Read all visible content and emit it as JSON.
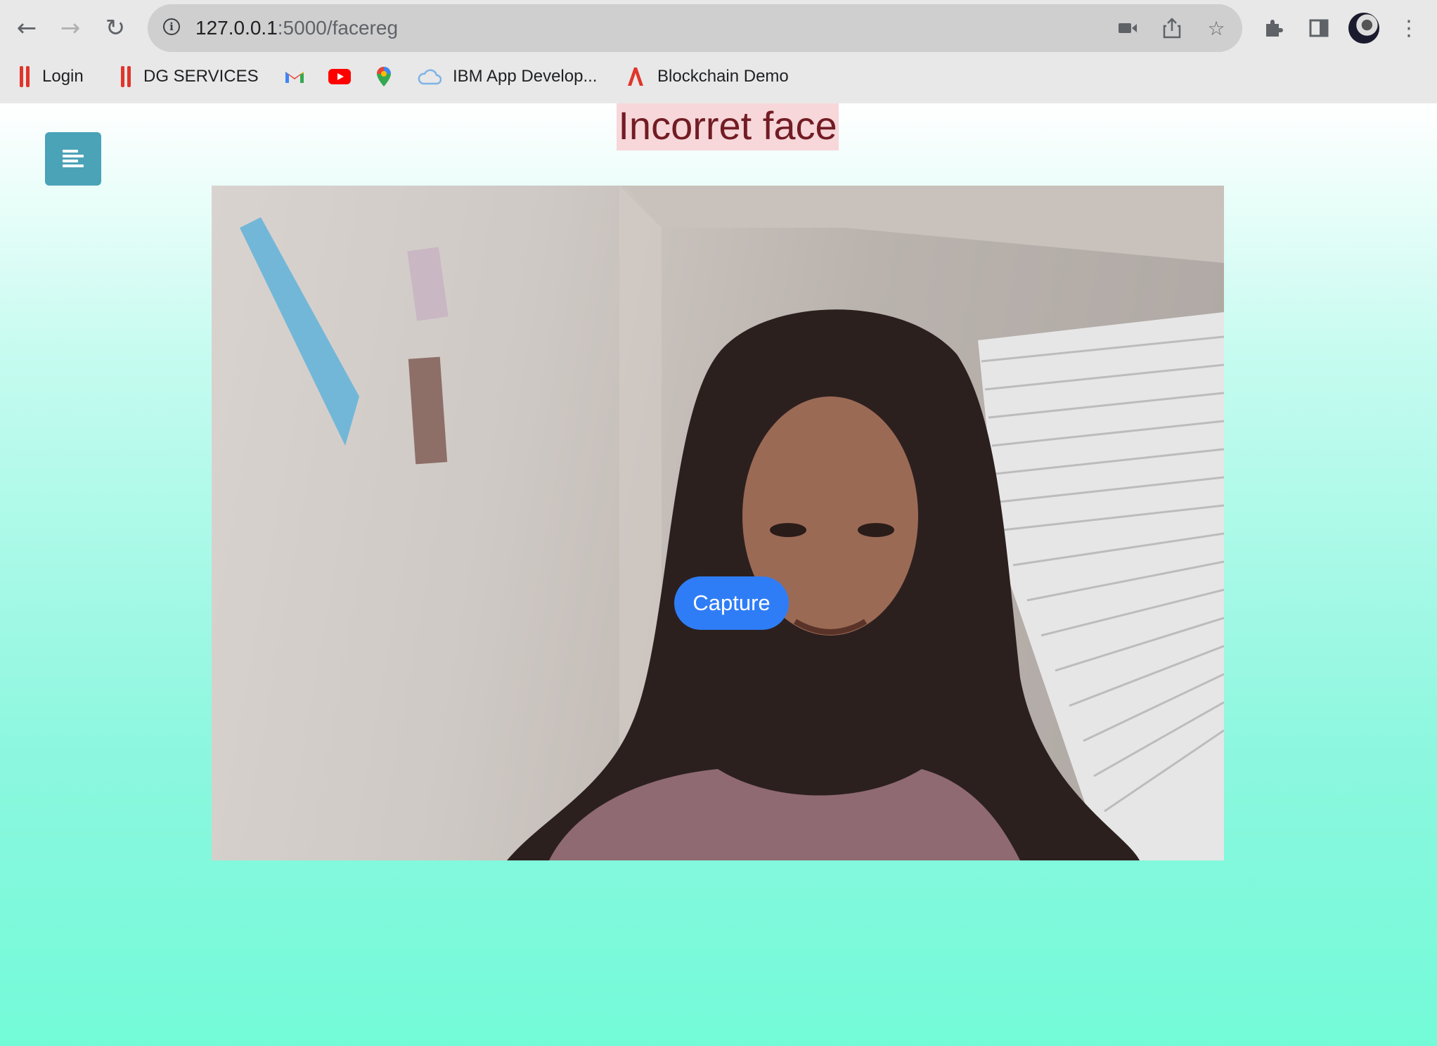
{
  "browser": {
    "url_host": "127.0.0.1",
    "url_path": ":5000/facereg",
    "nav": {
      "back_icon": "arrow-left-icon",
      "forward_icon": "arrow-right-icon",
      "reload_icon": "reload-icon"
    },
    "bookmarks": [
      {
        "label": "Login",
        "icon": "bars-logo-icon"
      },
      {
        "label": "DG SERVICES",
        "icon": "bars-logo-icon"
      },
      {
        "label": "",
        "icon": "gmail-icon"
      },
      {
        "label": "",
        "icon": "youtube-icon"
      },
      {
        "label": "",
        "icon": "maps-icon"
      },
      {
        "label": "IBM App Develop...",
        "icon": "cloud-icon"
      },
      {
        "label": "Blockchain Demo",
        "icon": "a-logo-icon"
      }
    ],
    "accent": "#e0352b"
  },
  "page": {
    "alert_text": "Incorret face",
    "alert_bg": "#f7d7da",
    "alert_color": "#721c24",
    "menu_toggle_color": "#4ba3b8",
    "capture_label": "Capture",
    "capture_color": "#2f7df6"
  }
}
